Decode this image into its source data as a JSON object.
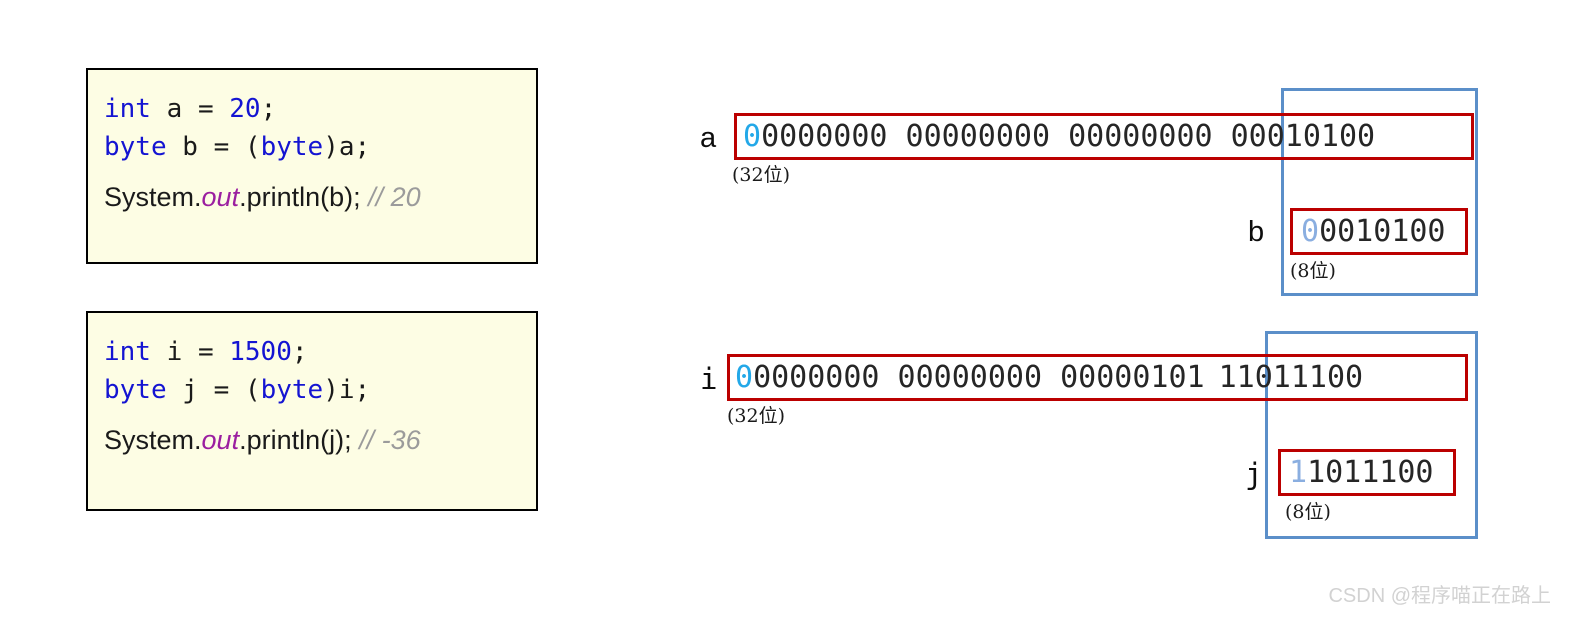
{
  "code_blocks": [
    {
      "id": "block-a",
      "lines": [
        {
          "tokens": [
            {
              "t": "int",
              "c": "kw"
            },
            {
              "t": " a ",
              "c": "plain"
            },
            {
              "t": "= ",
              "c": "plain"
            },
            {
              "t": "20",
              "c": "num"
            },
            {
              "t": ";",
              "c": "plain"
            }
          ],
          "style": "mono"
        },
        {
          "tokens": [
            {
              "t": "byte",
              "c": "kw"
            },
            {
              "t": " b ",
              "c": "plain"
            },
            {
              "t": "= (",
              "c": "plain"
            },
            {
              "t": "byte",
              "c": "kw"
            },
            {
              "t": ")a;",
              "c": "plain"
            }
          ],
          "style": "mono"
        },
        {
          "tokens": [
            {
              "t": "System.",
              "c": "plain"
            },
            {
              "t": "out",
              "c": "field"
            },
            {
              "t": ".println(b); ",
              "c": "plain"
            },
            {
              "t": "// 20",
              "c": "cmt"
            }
          ],
          "style": "prop"
        }
      ]
    },
    {
      "id": "block-i",
      "lines": [
        {
          "tokens": [
            {
              "t": "int",
              "c": "kw"
            },
            {
              "t": " i ",
              "c": "plain"
            },
            {
              "t": "= ",
              "c": "plain"
            },
            {
              "t": "1500",
              "c": "num"
            },
            {
              "t": ";",
              "c": "plain"
            }
          ],
          "style": "mono"
        },
        {
          "tokens": [
            {
              "t": "byte",
              "c": "kw"
            },
            {
              "t": " j ",
              "c": "plain"
            },
            {
              "t": "= (",
              "c": "plain"
            },
            {
              "t": "byte",
              "c": "kw"
            },
            {
              "t": ")i;",
              "c": "plain"
            }
          ],
          "style": "mono"
        },
        {
          "tokens": [
            {
              "t": "System.",
              "c": "plain"
            },
            {
              "t": "out",
              "c": "field"
            },
            {
              "t": ".println(j); ",
              "c": "plain"
            },
            {
              "t": "// -36",
              "c": "cmt"
            }
          ],
          "style": "prop"
        }
      ]
    }
  ],
  "diagram": {
    "groups": [
      {
        "id": "group-a",
        "wide": {
          "label": "a",
          "label_font": "sans",
          "bits_left": "00000000 00000000 00000000",
          "bits_right": "00010100",
          "highlight_first": "hi",
          "bitcount": "(32位)"
        },
        "narrow": {
          "label": "b",
          "label_font": "sans",
          "bits": "00010100",
          "highlight_first": "hi-soft",
          "bitcount": "(8位)"
        }
      },
      {
        "id": "group-i",
        "wide": {
          "label": "i",
          "label_font": "mono",
          "bits_left": "00000000 00000000 00000101",
          "bits_right": "11011100",
          "highlight_first": "hi",
          "bitcount": "(32位)"
        },
        "narrow": {
          "label": "j",
          "label_font": "mono",
          "bits": "11011100",
          "highlight_first": "hi-soft",
          "bitcount": "(8位)"
        }
      }
    ]
  },
  "watermark": "CSDN @程序喵正在路上",
  "colors": {
    "code_bg": "#fdfde4",
    "code_border": "#000000",
    "keyword_blue": "#1414d2",
    "field_purple": "#9b1fa0",
    "comment_gray": "#9b9b9b",
    "red_box": "#bb0000",
    "blue_box": "#5b8fc9",
    "highlight_cyan": "#23a8e8",
    "highlight_soft_blue": "#8aaee0",
    "watermark": "#d2d2d2"
  }
}
